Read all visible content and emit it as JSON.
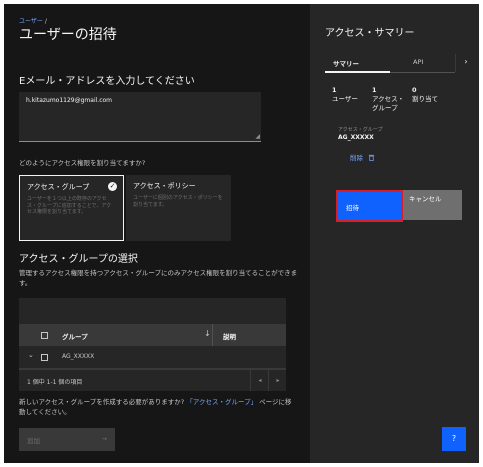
{
  "breadcrumb": {
    "parent": "ユーザー",
    "separator": "/"
  },
  "page_title": "ユーザーの招待",
  "email": {
    "label": "Eメール・アドレスを入力してください",
    "value": "h.kitazumo1129@gmail.com"
  },
  "assign": {
    "question": "どのようにアクセス権限を割り当てますか?",
    "tiles": [
      {
        "title": "アクセス・グループ",
        "desc": "ユーザーを１つ以上の既存のアクセス・グループに追加することで、アクセス権限を割り当てます。",
        "selected": true
      },
      {
        "title": "アクセス・ポリシー",
        "desc": "ユーザーに個別のアクセス・ポリシーを割り当てます。",
        "selected": false
      }
    ]
  },
  "group_select": {
    "title": "アクセス・グループの選択",
    "desc": "管理するアクセス権限を持つアクセス・グループにのみアクセス権限を割り当てることができます。"
  },
  "table": {
    "columns": [
      "グループ",
      "説明"
    ],
    "sort_icon": "arrow-down-icon",
    "rows": [
      {
        "group": "AG_XXXXX",
        "description": ""
      }
    ],
    "pagination": "1 個中 1-1 個の項目"
  },
  "info": {
    "prefix": "新しいアクセス・グループを作成する必要がありますか? ",
    "link": "「アクセス・グループ」",
    "suffix": " ページに移動してください。"
  },
  "add_button": {
    "label": "追加",
    "arrow": "→"
  },
  "summary": {
    "title": "アクセス・サマリー",
    "tabs": [
      "サマリー",
      "API"
    ],
    "next": "›",
    "stats": [
      {
        "num": "1",
        "label": "ユーザー"
      },
      {
        "num": "1",
        "label": "アクセス・グループ"
      },
      {
        "num": "0",
        "label": "割り当て"
      }
    ],
    "card": {
      "label": "アクセス・グループ",
      "value": "AG_XXXXX",
      "delete_label": "削除"
    },
    "invite_label": "招待",
    "cancel_label": "キャンセル"
  },
  "help_button": {
    "label": "?"
  },
  "colors": {
    "accent": "#0f62fe",
    "highlight": "#da1e28",
    "link": "#78a9ff"
  }
}
